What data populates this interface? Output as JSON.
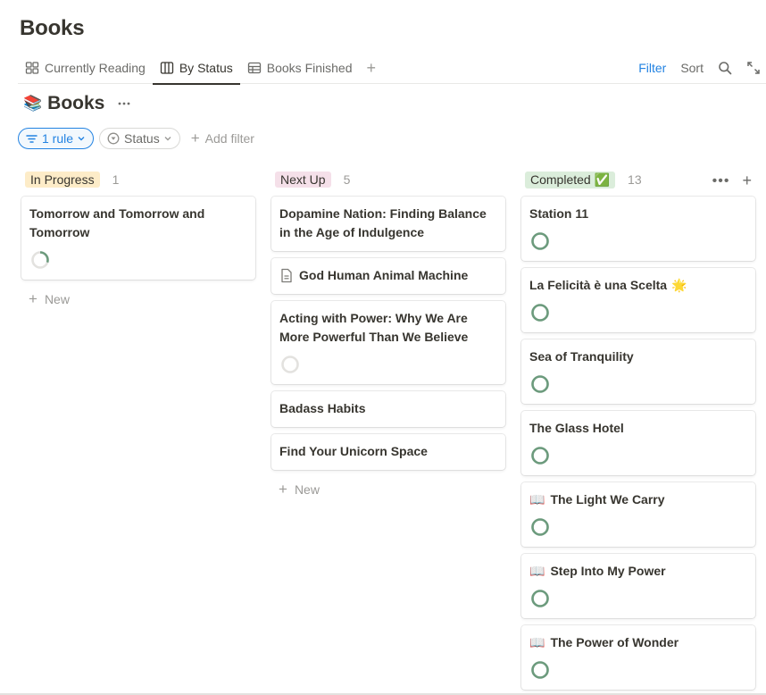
{
  "page": {
    "title": "Books"
  },
  "tabs": [
    {
      "label": "Currently Reading",
      "icon": "gallery-icon",
      "active": false
    },
    {
      "label": "By Status",
      "icon": "board-icon",
      "active": true
    },
    {
      "label": "Books Finished",
      "icon": "table-icon",
      "active": false
    }
  ],
  "toolbar": {
    "filter_label": "Filter",
    "sort_label": "Sort",
    "accent": "#2383e2"
  },
  "database": {
    "emoji": "📚",
    "title": "Books"
  },
  "filters": {
    "rule_label": "1 rule",
    "status_label": "Status",
    "add_filter_label": "Add filter"
  },
  "columns": {
    "in_progress": {
      "label": "In Progress",
      "count": "1",
      "color": "#fdecc8",
      "new_label": "New",
      "cards": [
        {
          "title": "Tomorrow and Tomorrow and Tomorrow",
          "progress": 0.3
        }
      ]
    },
    "next_up": {
      "label": "Next Up",
      "count": "5",
      "color": "#f5e0e9",
      "new_label": "New",
      "cards": [
        {
          "title": "Dopamine Nation: Finding Balance in the Age of Indulgence"
        },
        {
          "title": "God Human Animal Machine",
          "icon": "page-icon"
        },
        {
          "title": "Acting with Power: Why We Are More Powerful Than We Believe",
          "progress": 0
        },
        {
          "title": "Badass Habits"
        },
        {
          "title": "Find Your Unicorn Space"
        }
      ]
    },
    "completed": {
      "label": "Completed ✅",
      "count": "13",
      "color": "#dbeddb",
      "cards": [
        {
          "title": "Station 11",
          "progress": 1
        },
        {
          "title": "La Felicità è una Scelta",
          "trail_emoji": "🌟",
          "progress": 1
        },
        {
          "title": "Sea of Tranquility",
          "progress": 1
        },
        {
          "title": "The Glass Hotel",
          "progress": 1
        },
        {
          "emoji": "📖",
          "title": "The Light We Carry",
          "progress": 1
        },
        {
          "emoji": "📖",
          "title": "Step Into My Power",
          "progress": 1
        },
        {
          "emoji": "📖",
          "title": "The Power of Wonder",
          "progress": 1
        }
      ]
    }
  },
  "colors": {
    "progress_complete": "#6c9b7d",
    "progress_partial": "#6c9b7d",
    "progress_track": "#e3e2df"
  }
}
